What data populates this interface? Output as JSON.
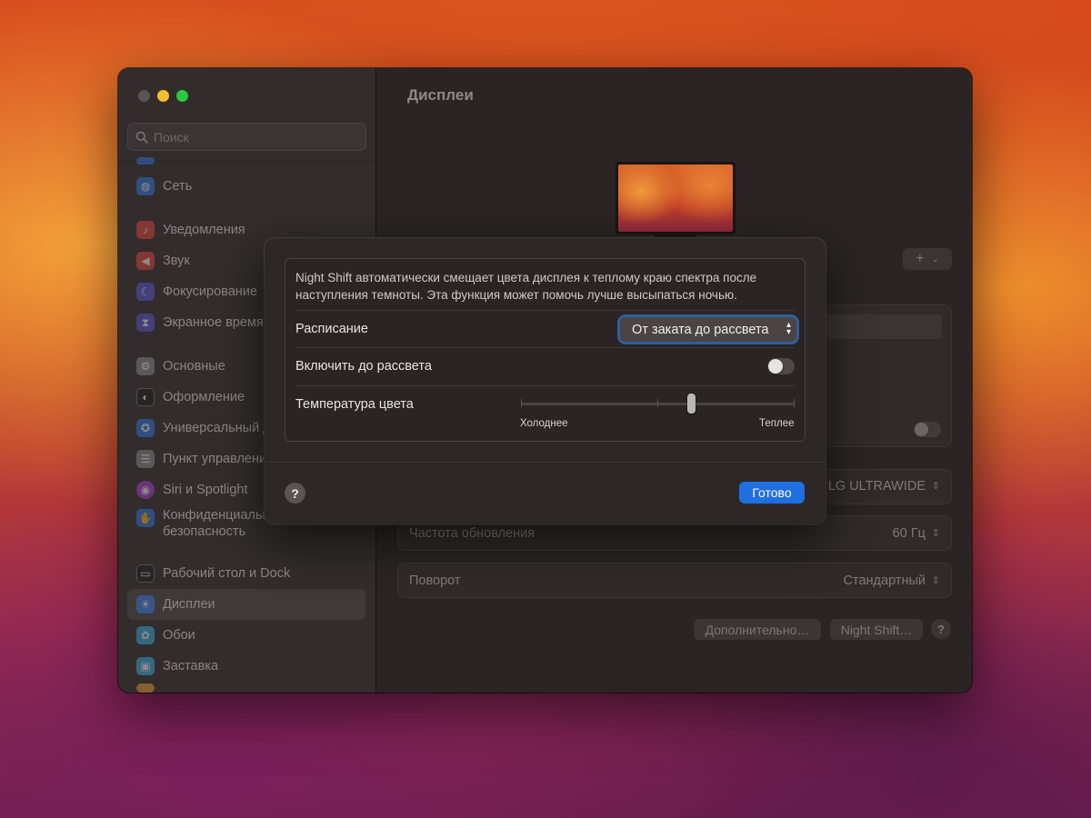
{
  "sidebar": {
    "search_placeholder": "Поиск",
    "items": [
      {
        "label": "Сеть",
        "icon": "globe-icon",
        "color": "#2f7be6"
      },
      {
        "label": "Уведомления",
        "icon": "bell-icon",
        "color": "#e8453c"
      },
      {
        "label": "Звук",
        "icon": "speaker-icon",
        "color": "#e8453c"
      },
      {
        "label": "Фокусирование",
        "icon": "moon-icon",
        "color": "#5b55d6"
      },
      {
        "label": "Экранное время",
        "icon": "hourglass-icon",
        "color": "#5b55d6"
      },
      {
        "label": "Основные",
        "icon": "gear-icon",
        "color": "#8e8e93"
      },
      {
        "label": "Оформление",
        "icon": "appearance-icon",
        "color": "#1c1c1e"
      },
      {
        "label": "Универсальный доступ",
        "icon": "accessibility-icon",
        "color": "#2f7be6"
      },
      {
        "label": "Пункт управления",
        "icon": "control-center-icon",
        "color": "#8e8e93"
      },
      {
        "label": "Siri и Spotlight",
        "icon": "siri-icon",
        "color": "#b13fd6"
      },
      {
        "label": "Конфиденциальность и безопасность",
        "label_line1": "Конфиденциальность и",
        "label_line2": "безопасность",
        "icon": "hand-icon",
        "color": "#2f7be6"
      },
      {
        "label": "Рабочий стол и Dock",
        "icon": "dock-icon",
        "color": "#1c1c1e"
      },
      {
        "label": "Дисплеи",
        "icon": "brightness-icon",
        "color": "#2f7be6",
        "selected": true
      },
      {
        "label": "Обои",
        "icon": "flower-icon",
        "color": "#3ab0e6"
      },
      {
        "label": "Заставка",
        "icon": "screensaver-icon",
        "color": "#3ab0e6"
      }
    ]
  },
  "main": {
    "title": "Дисплеи",
    "add_label": "+",
    "display_name": "LG ULTRAWIDE",
    "refresh_label": "Частота обновления",
    "refresh_value": "60 Гц",
    "rotation_label": "Поворот",
    "rotation_value": "Стандартный",
    "advanced_button": "Дополнительно…",
    "night_shift_button": "Night Shift…",
    "help": "?"
  },
  "sheet": {
    "description": "Night Shift автоматически смещает цвета дисплея к теплому краю спектра после наступления темноты. Эта функция может помочь лучше высыпаться ночью.",
    "schedule_label": "Расписание",
    "schedule_value": "От заката до рассвета",
    "enable_label": "Включить до рассвета",
    "enable_on": false,
    "temperature_label": "Температура цвета",
    "temperature_level": 0.62,
    "cold_label": "Холоднее",
    "warm_label": "Теплее",
    "help": "?",
    "done_button": "Готово"
  },
  "colors": {
    "accent": "#1f6fe0",
    "focus_ring": "#2f5f9a"
  }
}
